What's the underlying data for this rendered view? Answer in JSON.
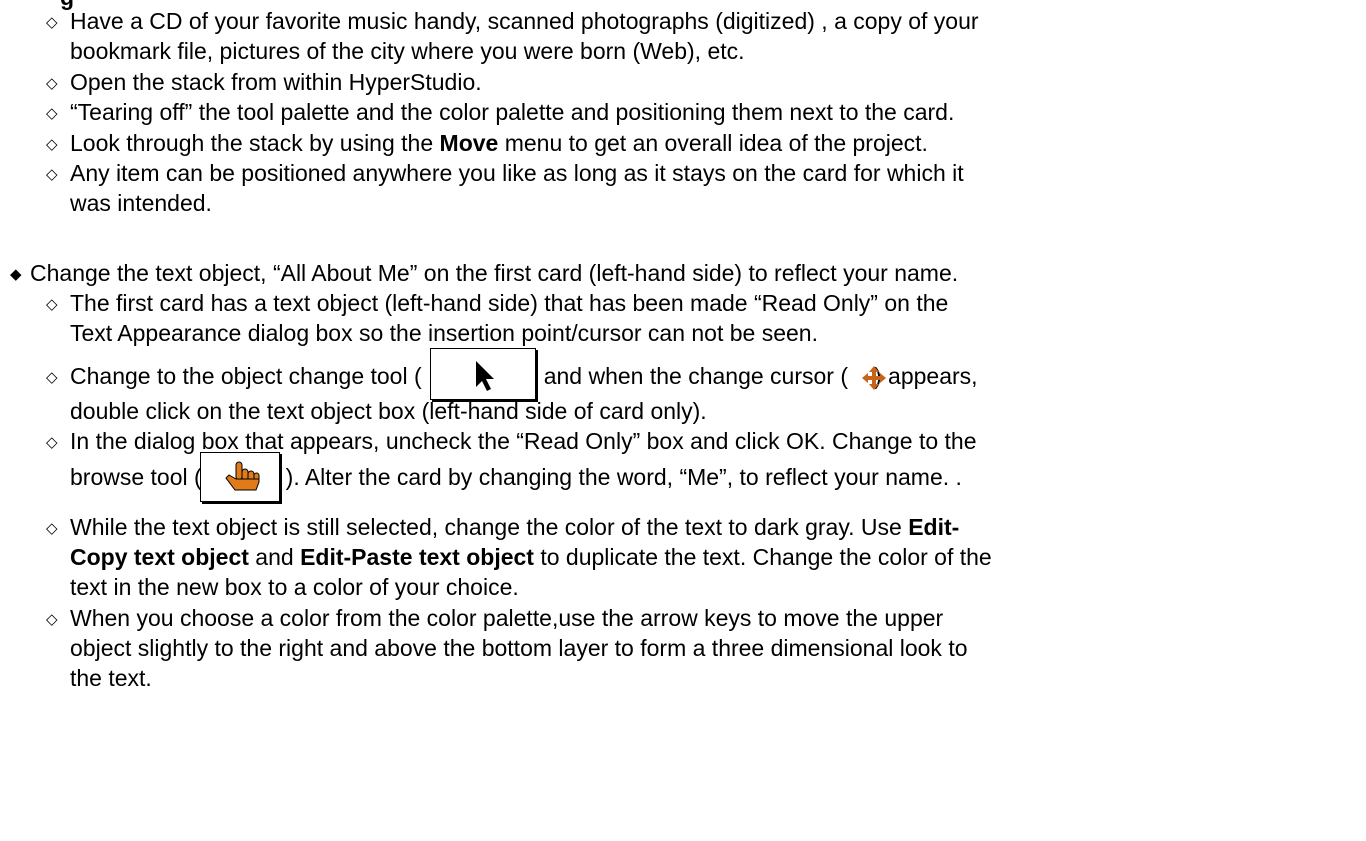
{
  "cutoff_heading": "g",
  "section1": {
    "items": [
      {
        "lines": [
          "Have a CD of your favorite music handy, scanned photographs (digitized) , a copy of your",
          "bookmark file, pictures of the city where you were born (Web), etc."
        ]
      },
      {
        "lines": [
          "Open the stack from within HyperStudio."
        ]
      },
      {
        "lines": [
          "“Tearing off” the tool palette and the color palette and positioning them next to the card."
        ]
      },
      {
        "pre": "Look through the stack by using the ",
        "bold": "Move",
        "post": " menu to get an overall idea of the project."
      },
      {
        "lines": [
          "Any item can be positioned anywhere you like as long as it stays on the card for which it",
          "was intended."
        ]
      }
    ]
  },
  "section2": {
    "main": "Change the text object, “All About Me” on the first card (left-hand side) to reflect your name.",
    "item1": [
      "The first card has a text object (left-hand side) that has been made “Read Only” on the",
      "Text Appearance dialog box so the insertion point/cursor can not be seen."
    ],
    "item2": {
      "pre": "Change to the object change tool (",
      "mid": ") and when the change cursor (",
      "post": ") appears,",
      "line2": "double click on the text object box (left-hand side of card only)."
    },
    "item3": {
      "line1": "In the dialog box that appears, uncheck the “Read Only” box and click OK.  Change to the",
      "pre2": "browse tool (",
      "post2": ").  Alter the card by changing the word, “Me”, to reflect your name.  ."
    },
    "item4": {
      "pre1": "While the text object is still selected, change the color of the text to dark gray.  Use ",
      "bold1": "Edit-",
      "bold2": "Copy text object",
      "mid2": " and ",
      "bold3": "Edit-Paste text object",
      "post2": " to duplicate the text.  Change the color of the",
      "line3": "text in the new box to a color of your choice."
    },
    "item5": [
      "When you choose a color from the color palette,use the arrow keys to move the upper",
      "object slightly to the right and above the bottom layer to form a three dimensional look to",
      "the text."
    ]
  },
  "colors": {
    "hand_icon": "#e07a1a",
    "cursor_icon": "#c8641a"
  }
}
